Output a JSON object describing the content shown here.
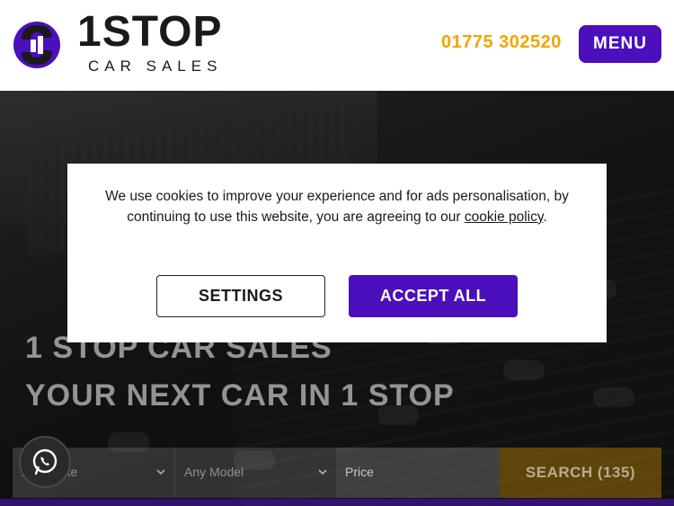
{
  "header": {
    "logo_main": "1STOP",
    "logo_sub": "CAR SALES",
    "phone": "01775 302520",
    "menu_label": "MENU"
  },
  "hero": {
    "title_line1": "1 STOP CAR SALES",
    "title_line2": "YOUR NEXT CAR IN 1 STOP"
  },
  "search": {
    "make_placeholder": "Any Make",
    "model_placeholder": "Any Model",
    "price_placeholder": "Price",
    "button_label": "SEARCH (135)"
  },
  "cookie": {
    "message_before": "We use cookies to improve your experience and for ads personalisation, by continuing to use this website, you are agreeing to our ",
    "link_text": "cookie policy",
    "message_after": ".",
    "settings_label": "SETTINGS",
    "accept_label": "ACCEPT ALL"
  },
  "colors": {
    "brand_purple": "#4b0fbc",
    "accent_orange": "#f0a500"
  },
  "icons": {
    "logo": "1stop-logo-icon",
    "whatsapp": "whatsapp-icon",
    "chevron": "chevron-down-icon"
  }
}
